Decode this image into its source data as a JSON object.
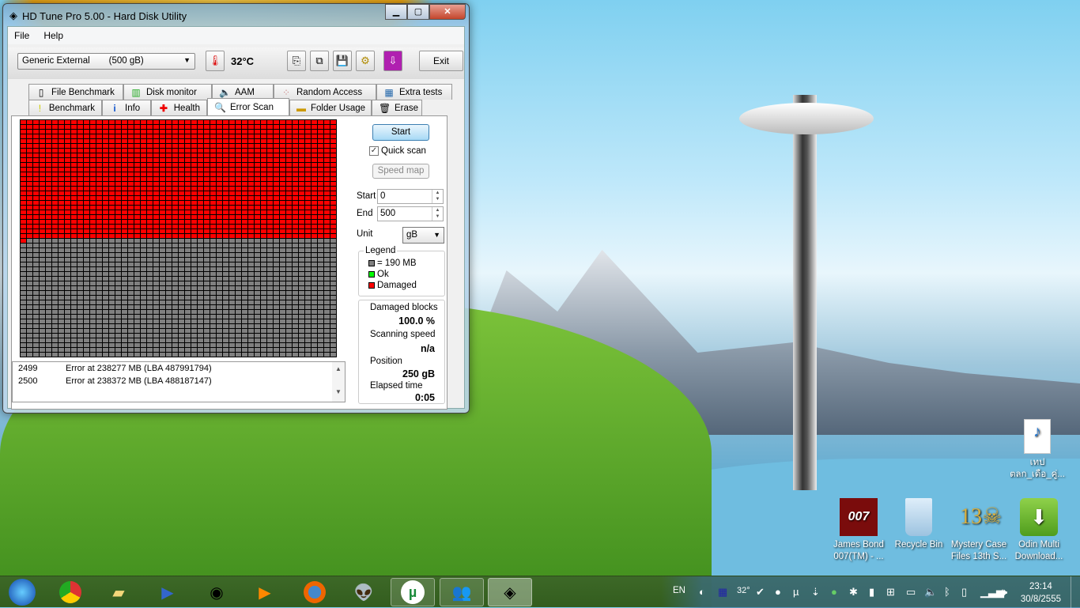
{
  "window": {
    "title": "HD Tune Pro 5.00 - Hard Disk Utility"
  },
  "menu": [
    "File",
    "Help"
  ],
  "toolbar": {
    "drive_name": "Generic External",
    "drive_capacity": "(500 gB)",
    "temperature": "32°C",
    "exit_label": "Exit"
  },
  "tabs_row1": [
    {
      "label": "File Benchmark",
      "icon": "file-benchmark-icon"
    },
    {
      "label": "Disk monitor",
      "icon": "disk-monitor-icon"
    },
    {
      "label": "AAM",
      "icon": "speaker-icon"
    },
    {
      "label": "Random Access",
      "icon": "random-access-icon"
    },
    {
      "label": "Extra tests",
      "icon": "extra-tests-icon"
    }
  ],
  "tabs_row2": [
    {
      "label": "Benchmark",
      "icon": "benchmark-icon"
    },
    {
      "label": "Info",
      "icon": "info-icon"
    },
    {
      "label": "Health",
      "icon": "health-icon"
    },
    {
      "label": "Error Scan",
      "icon": "magnifier-icon",
      "active": true
    },
    {
      "label": "Folder Usage",
      "icon": "folder-icon"
    },
    {
      "label": "Erase",
      "icon": "trash-icon"
    }
  ],
  "scan": {
    "columns": 50,
    "rows": 50,
    "damaged_blocks_drawn": 1251,
    "colors": {
      "damaged": "#ff0000",
      "ok": "#00ff00",
      "unscanned": "#808080"
    }
  },
  "log": [
    {
      "n": "2499",
      "msg": "Error at 238277 MB (LBA 487991794)"
    },
    {
      "n": "2500",
      "msg": "Error at 238372 MB (LBA 488187147)"
    }
  ],
  "controls": {
    "start_label": "Start",
    "quick_scan_label": "Quick scan",
    "quick_scan_checked": true,
    "speed_map_label": "Speed map",
    "start_field_label": "Start",
    "start_value": "0",
    "end_field_label": "End",
    "end_value": "500",
    "unit_label": "Unit",
    "unit_value": "gB"
  },
  "legend": {
    "title": "Legend",
    "block": "= 190 MB",
    "ok": "Ok",
    "damaged": "Damaged"
  },
  "stats": {
    "damaged_label": "Damaged blocks",
    "damaged_value": "100.0 %",
    "speed_label": "Scanning speed",
    "speed_value": "n/a",
    "position_label": "Position",
    "position_value": "250 gB",
    "elapsed_label": "Elapsed time",
    "elapsed_value": "0:05"
  },
  "desktop_icons": [
    {
      "label": "เทป ตลก_เดือ_คู่...",
      "icon": "mp3-file-icon"
    },
    {
      "label": "James Bond 007(TM) - ...",
      "icon": "james-bond-icon"
    },
    {
      "label": "Recycle Bin",
      "icon": "recycle-bin-icon"
    },
    {
      "label": "Mystery Case Files 13th S...",
      "icon": "mystery-case-icon"
    },
    {
      "label": "Odin Multi Download...",
      "icon": "odin-icon"
    }
  ],
  "tray": {
    "language": "EN",
    "temp": "32°",
    "time": "23:14",
    "date": "30/8/2555"
  }
}
